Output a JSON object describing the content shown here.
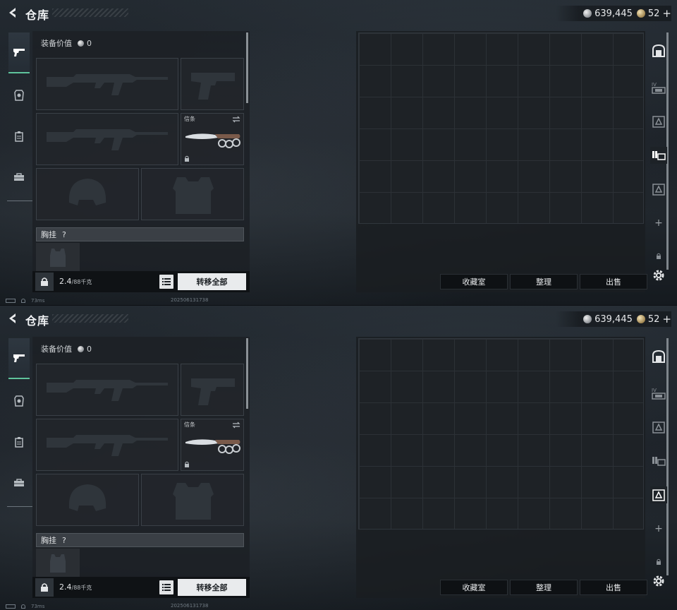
{
  "screens": [
    {
      "header": {
        "title": "仓库"
      },
      "currency": {
        "silver": "639,445",
        "gold": "52",
        "plus": "+"
      },
      "equipment": {
        "value_label": "装备价值",
        "value": "0",
        "knife_label": "信条",
        "chest_label": "胸挂",
        "chest_help": "?",
        "weight_value": "2.4",
        "weight_max": "/88千克",
        "transfer_all": "转移全部"
      },
      "actions": {
        "collection": "收藏室",
        "sort": "整理",
        "sell": "出售"
      },
      "right_rail": {
        "plus": "+",
        "active_index": 3
      },
      "status": {
        "ping": "73ms",
        "build": "202506131738"
      }
    },
    {
      "header": {
        "title": "仓库"
      },
      "currency": {
        "silver": "639,445",
        "gold": "52",
        "plus": "+"
      },
      "equipment": {
        "value_label": "装备价值",
        "value": "0",
        "knife_label": "信条",
        "chest_label": "胸挂",
        "chest_help": "?",
        "weight_value": "2.4",
        "weight_max": "/88千克",
        "transfer_all": "转移全部"
      },
      "actions": {
        "collection": "收藏室",
        "sort": "整理",
        "sell": "出售"
      },
      "right_rail": {
        "plus": "+",
        "active_index": 4
      },
      "status": {
        "ping": "73ms",
        "build": "202506131738"
      }
    }
  ],
  "colors": {
    "accent": "#5fc39c",
    "panel": "#1c2025",
    "button_light": "#e9ebed"
  },
  "icons": [
    "back-arrow-icon",
    "pistol-tab-icon",
    "armor-tab-icon",
    "backpack-tab-icon",
    "briefcase-tab-icon",
    "rifle-icon",
    "pistol-icon",
    "knife-icon",
    "helmet-icon",
    "vest-icon",
    "lock-icon",
    "list-icon",
    "safe-icon",
    "storage-icon",
    "gear-icon"
  ]
}
